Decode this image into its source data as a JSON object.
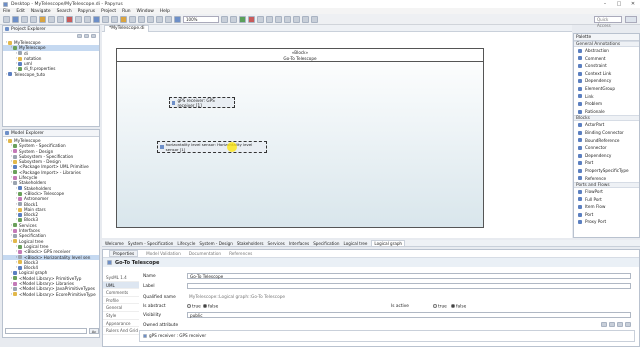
{
  "window": {
    "title": "Desktop - MyTelescope/MyTelescope.di - Papyrus"
  },
  "menu": [
    "File",
    "Edit",
    "Navigate",
    "Search",
    "Papyrus",
    "Project",
    "Run",
    "Window",
    "Help"
  ],
  "toolbar": {
    "zoom": "100%",
    "quick_access": "Quick Access"
  },
  "project_explorer": {
    "tab": "Project Explorer",
    "items": [
      {
        "label": "MyTelescope",
        "level": 0
      },
      {
        "label": "MyTelescope",
        "level": 1
      },
      {
        "label": "di",
        "level": 2
      },
      {
        "label": "notation",
        "level": 2
      },
      {
        "label": "uml",
        "level": 2
      },
      {
        "label": "di_fr.properties",
        "level": 2
      },
      {
        "label": "Telescope_tuto",
        "level": 0
      }
    ]
  },
  "model_explorer": {
    "tab": "Model Explorer",
    "items": [
      {
        "label": "MyTelescope",
        "level": 0
      },
      {
        "label": "System - Specification",
        "level": 1
      },
      {
        "label": "System - Design",
        "level": 1
      },
      {
        "label": "Subsystem - Specification",
        "level": 1
      },
      {
        "label": "Subsystem - Design",
        "level": 1
      },
      {
        "label": "<Package Import> UML Primitive",
        "level": 1
      },
      {
        "label": "<Package Import> - Libraries",
        "level": 1
      },
      {
        "label": "Lifecycle",
        "level": 1
      },
      {
        "label": "Stakeholders",
        "level": 1
      },
      {
        "label": "Stakeholders",
        "level": 2
      },
      {
        "label": "<Block> Telescope",
        "level": 2
      },
      {
        "label": "Astronomer",
        "level": 2
      },
      {
        "label": "Block1",
        "level": 2
      },
      {
        "label": "Main stars",
        "level": 2
      },
      {
        "label": "Block2",
        "level": 2
      },
      {
        "label": "Block3",
        "level": 2
      },
      {
        "label": "Services",
        "level": 1
      },
      {
        "label": "Interfaces",
        "level": 1
      },
      {
        "label": "Specification",
        "level": 1
      },
      {
        "label": "Logical tree",
        "level": 1
      },
      {
        "label": "Logical tree",
        "level": 2
      },
      {
        "label": "<Block> GPS receiver",
        "level": 2
      },
      {
        "label": "<Block> Horizontality level sen",
        "level": 2
      },
      {
        "label": "Block3",
        "level": 2
      },
      {
        "label": "Block4",
        "level": 2
      },
      {
        "label": "Logical graph",
        "level": 1
      },
      {
        "label": "<Model Library> PrimitiveTyp",
        "level": 1
      },
      {
        "label": "<Model Library> Libraries",
        "level": 1
      },
      {
        "label": "<Model Library> JavaPrimitiveTypes",
        "level": 1
      },
      {
        "label": "<Model Library> EcorePrimitiveType",
        "level": 1
      }
    ],
    "filter_placeholder": "",
    "filter_button": "Ac"
  },
  "editor": {
    "tab": "*MyTelescope.di",
    "block": {
      "stereotype": "«Block»",
      "name": "Go-To Telescope"
    },
    "parts": [
      {
        "label": "gPS receiver: GPS receiver [1]"
      },
      {
        "label": "horizontality level sensor: Horizontality level sensor [1]"
      }
    ]
  },
  "palette": {
    "title": "Palette",
    "groups": [
      {
        "name": "General Annotations",
        "items": [
          "Abstraction",
          "Comment",
          "Constraint",
          "Context Link",
          "Dependency",
          "ElementGroup",
          "Link",
          "Problem",
          "Rationale"
        ]
      },
      {
        "name": "Blocks",
        "items": [
          "ActorPart",
          "Binding Connector",
          "BoundReference",
          "Connector",
          "Dependency",
          "Part",
          "PropertySpecificType",
          "Reference"
        ]
      },
      {
        "name": "Ports and Flows",
        "items": [
          "FlowPort",
          "Full Port",
          "Item Flow",
          "Port",
          "Proxy Port"
        ]
      }
    ]
  },
  "diagram_tabs": [
    "Welcome",
    "System - Specification",
    "Lifecycle",
    "System - Design",
    "Stakeholders",
    "Services",
    "Interfaces",
    "Specification",
    "Logical tree",
    "Logical graph"
  ],
  "properties": {
    "tabs": [
      "Properties",
      "Model Validation",
      "Documentation",
      "References"
    ],
    "title": "Go-To Telescope",
    "side_tabs": [
      "SysML 1.4",
      "UML",
      "Comments",
      "Profile",
      "General",
      "Style",
      "Appearance",
      "Rulers And Grid"
    ],
    "name_label": "Name",
    "name_value": "Go-To Telescope",
    "label_label": "Label",
    "label_value": "",
    "qualified_label": "Qualified name",
    "qualified_value": "MyTelescope::Logical graph::Go-To Telescope",
    "is_abstract_label": "Is abstract",
    "is_active_label": "Is active",
    "true_label": "true",
    "false_label": "false",
    "visibility_label": "Visibility",
    "visibility_value": "public",
    "owned_attribute_label": "Owned attribute",
    "owned_attribute_value": "gPS receiver : GPS receiver"
  }
}
